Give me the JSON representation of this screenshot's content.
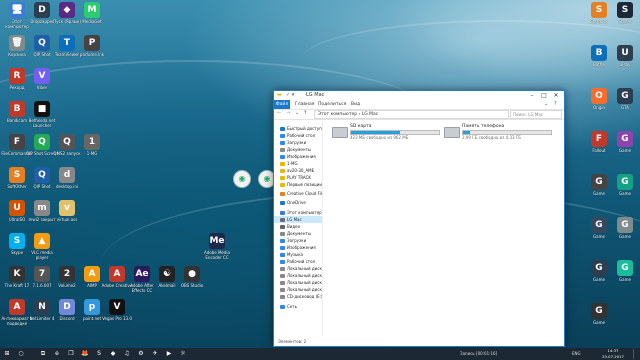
{
  "desktop": {
    "icons_left": [
      {
        "label": "Этот компьютер",
        "glyph": "🖥",
        "color": "#3a7bd5"
      },
      {
        "label": "Dropzapper",
        "glyph": "D",
        "color": "#2c3e50"
      },
      {
        "label": "Пуск (Ярлык)",
        "glyph": "◆",
        "color": "#5b2a86"
      },
      {
        "label": "MediaGet",
        "glyph": "M",
        "color": "#2ecc71"
      },
      {
        "label": "Корзина",
        "glyph": "🗑",
        "color": "#7f8c8d"
      },
      {
        "label": "QIP Shot",
        "glyph": "Q",
        "color": "#1f5fa8"
      },
      {
        "label": "TeamViewer",
        "glyph": "T",
        "color": "#0e6eb8"
      },
      {
        "label": "parfume.lnk",
        "glyph": "P",
        "color": "#444"
      },
      {
        "label": "Рекорд",
        "glyph": "R",
        "color": "#c0392b"
      },
      {
        "label": "Viber",
        "glyph": "V",
        "color": "#7360f2"
      },
      {
        "label": "Bandicam",
        "glyph": "B",
        "color": "#c0392b"
      },
      {
        "label": "Bethesda.net Launcher",
        "glyph": "■",
        "color": "#111"
      },
      {
        "label": "FileCommander",
        "glyph": "F",
        "color": "#444"
      },
      {
        "label": "QIP Shot Screen",
        "glyph": "Q",
        "color": "#2a5"
      },
      {
        "label": "QMS2 запуск",
        "glyph": "Q",
        "color": "#555"
      },
      {
        "label": "1-MG",
        "glyph": "1",
        "color": "#666"
      },
      {
        "label": "SoftOther",
        "glyph": "S",
        "color": "#e67e22"
      },
      {
        "label": "QIP Shot",
        "glyph": "Q",
        "color": "#1f5fa8"
      },
      {
        "label": "desktop.ini",
        "glyph": "d",
        "color": "#888"
      },
      {
        "label": "UltraISO",
        "glyph": "U",
        "color": "#d35400"
      },
      {
        "label": "mwl2 закрыт",
        "glyph": "m",
        "color": "#888"
      },
      {
        "label": "virtual.ass",
        "glyph": "v",
        "color": "#e1c16e"
      },
      {
        "label": "Skype",
        "glyph": "S",
        "color": "#00aff0"
      },
      {
        "label": "VLC media player",
        "glyph": "▲",
        "color": "#f39c12"
      },
      {
        "label": "Adobe Media Encoder CC",
        "glyph": "Me",
        "color": "#1d2a4d"
      },
      {
        "label": "The Kraft 17",
        "glyph": "K",
        "color": "#333"
      },
      {
        "label": "7.1.6.007",
        "glyph": "7",
        "color": "#555"
      },
      {
        "label": "Volume2",
        "glyph": "2",
        "color": "#333"
      },
      {
        "label": "AIMP",
        "glyph": "A",
        "color": "#f39c12"
      },
      {
        "label": "Adobe Creative",
        "glyph": "A",
        "color": "#c0392b"
      },
      {
        "label": "Adobe After Effects CC",
        "glyph": "Ae",
        "color": "#2a1a5e"
      },
      {
        "label": "Akelmail",
        "glyph": "☯",
        "color": "#222"
      },
      {
        "label": "OBS Studio",
        "glyph": "●",
        "color": "#333"
      },
      {
        "label": "Антиквариат в подводке",
        "glyph": "A",
        "color": "#c0392b"
      },
      {
        "label": "NetLimiter 4",
        "glyph": "N",
        "color": "#2c3e50"
      },
      {
        "label": "Discord",
        "glyph": "D",
        "color": "#7289da"
      },
      {
        "label": "paint.net",
        "glyph": "p",
        "color": "#3498db"
      },
      {
        "label": "Vegas Pro 13.0",
        "glyph": "V",
        "color": "#111"
      }
    ],
    "icons_right": [
      {
        "label": "Stardock",
        "glyph": "S",
        "color": "#e67e22"
      },
      {
        "label": "Steam",
        "glyph": "S",
        "color": "#1b2838"
      },
      {
        "label": "Battle",
        "glyph": "B",
        "color": "#0e6eb8"
      },
      {
        "label": "uPlay",
        "glyph": "U",
        "color": "#2c3e50"
      },
      {
        "label": "Origin",
        "glyph": "O",
        "color": "#f56c2d"
      },
      {
        "label": "GTA",
        "glyph": "G",
        "color": "#2c3e50"
      },
      {
        "label": "Fallout",
        "glyph": "F",
        "color": "#c0392b"
      },
      {
        "label": "Game",
        "glyph": "G",
        "color": "#8e44ad"
      },
      {
        "label": "Game",
        "glyph": "G",
        "color": "#444"
      },
      {
        "label": "Game",
        "glyph": "G",
        "color": "#16a085"
      },
      {
        "label": "Game",
        "glyph": "G",
        "color": "#34495e"
      },
      {
        "label": "Game",
        "glyph": "G",
        "color": "#7f8c8d"
      },
      {
        "label": "Game",
        "glyph": "G",
        "color": "#2c3e50"
      },
      {
        "label": "Game",
        "glyph": "G",
        "color": "#1abc9c"
      },
      {
        "label": "Game",
        "glyph": "G",
        "color": "#333"
      }
    ]
  },
  "explorer": {
    "title": "LG Mac",
    "tabs": [
      "Файл",
      "Главная",
      "Поделиться",
      "Вид"
    ],
    "address": "Этот компьютер  ›  LG Mac",
    "search_placeholder": "Поиск: LG Mac",
    "nav_items": [
      "Быстрый доступ",
      "Рабочий стол",
      "Загрузки",
      "Документы",
      "Изображения",
      "1-MG",
      "av20-30_AME",
      "PLAY TRACK",
      "Первые позиции",
      "Creative Cloud Fil",
      "OneDrive",
      "Этот компьютер",
      "LG Mac",
      "Видео",
      "Документы",
      "Загрузки",
      "Изображения",
      "Музыка",
      "Рабочий стол",
      "Локальный диск",
      "Локальный диск",
      "Локальный диск",
      "Локальный диск",
      "CD-дисковод (E:)",
      "Сеть"
    ],
    "selected_nav": "LG Mac",
    "devices": [
      {
        "name": "SD карта",
        "free": "423 МБ свободно из 962 МБ",
        "used_fraction": 0.56
      },
      {
        "name": "Память телефона",
        "free": "3,99 ГБ свободно из 4,33 ГБ",
        "used_fraction": 0.08
      }
    ],
    "status": "Элементов: 2"
  },
  "floaters": [
    {
      "label": "Hotspot"
    },
    {
      "label": "Hotspot"
    }
  ],
  "taskbar": {
    "start_glyph": "⊞",
    "search_glyph": "○",
    "items": [
      "⧉",
      "e",
      "❐",
      "🦊",
      "S",
      "◆",
      "♫",
      "⚙",
      "✈",
      "▶",
      "☼"
    ],
    "record_label": "Запись [00:01:16]",
    "tray": "ENG",
    "time": "14:37",
    "date": "23.07.2017"
  }
}
